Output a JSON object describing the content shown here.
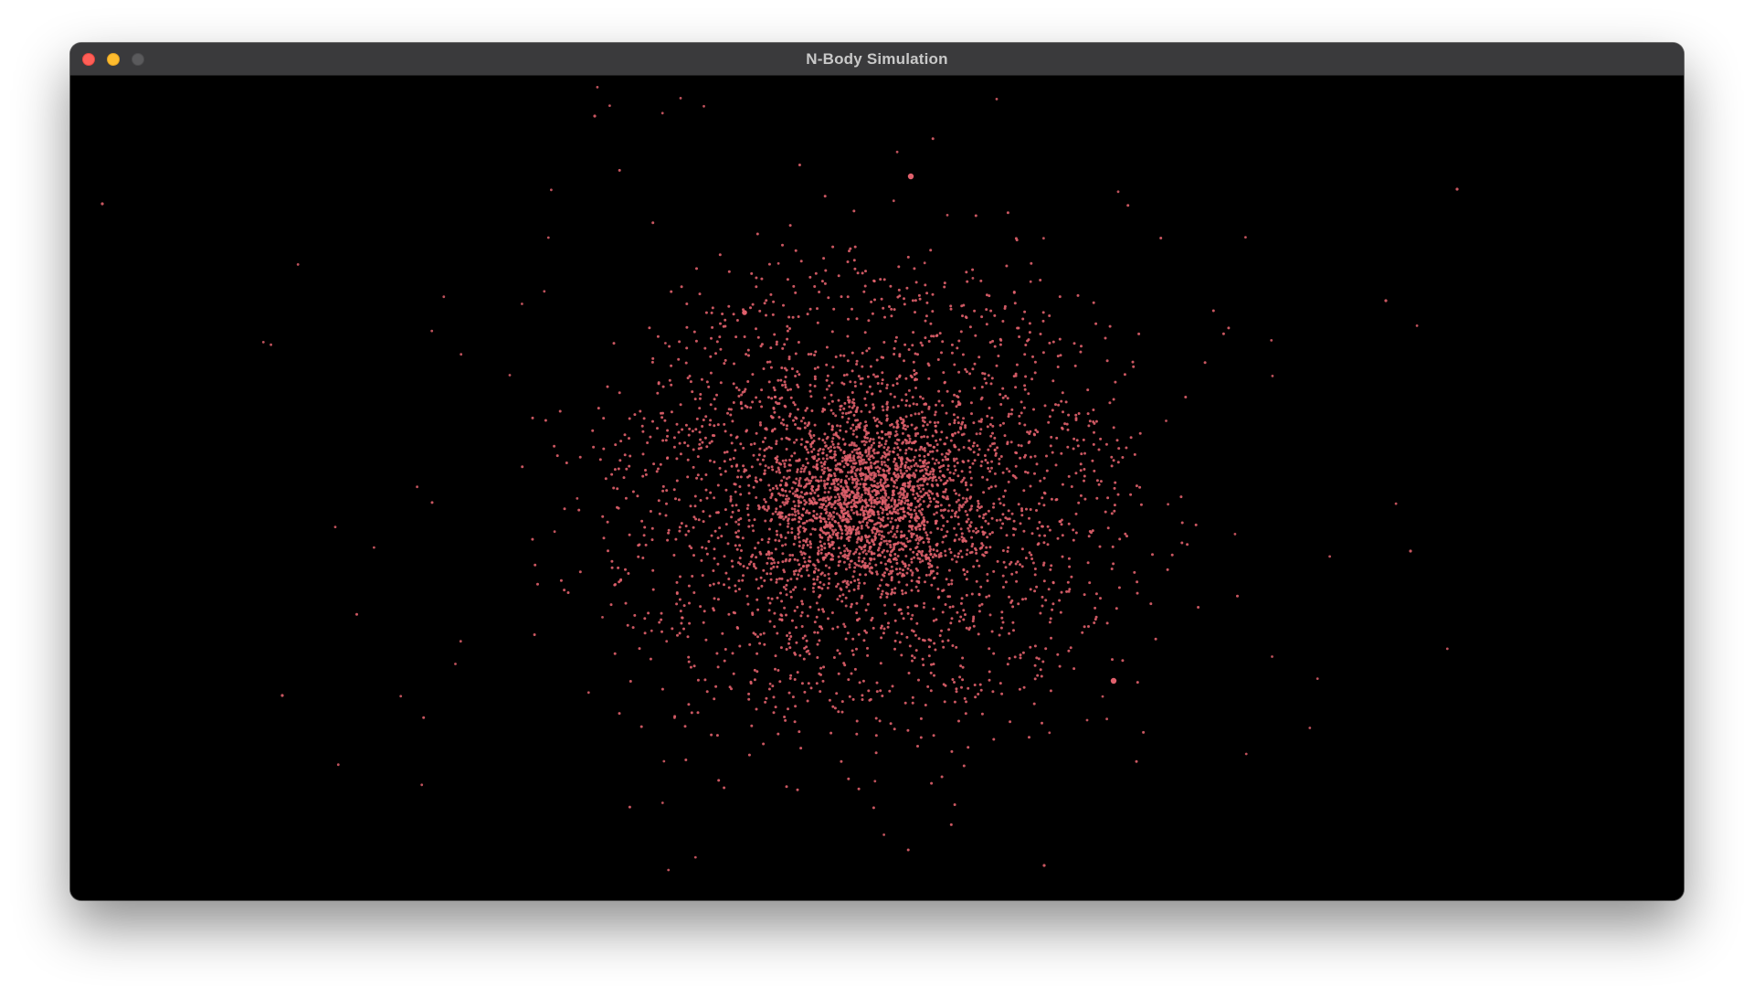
{
  "window": {
    "title": "N-Body Simulation"
  },
  "simulation": {
    "particle_color": "#e0606c",
    "background_color": "#000000",
    "heavy_bodies": 3
  },
  "icons": {
    "close": "close-icon",
    "minimize": "minimize-icon",
    "zoom": "zoom-icon"
  }
}
